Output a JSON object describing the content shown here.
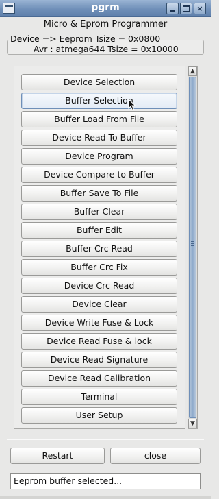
{
  "window": {
    "title": "pgrm",
    "app_title": "Micro & Eprom Programmer",
    "device_line": "Device => Eeprom Tsize = 0x0800",
    "avr_line": "Avr : atmega644  Tsize = 0x10000",
    "controls": {
      "minimize": "",
      "maximize": "",
      "close": "×"
    }
  },
  "menu_buttons": [
    "Device Selection",
    "Buffer Selection",
    "Buffer Load From File",
    "Device Read To Buffer",
    "Device Program",
    "Device Compare to Buffer",
    "Buffer Save To File",
    "Buffer Clear",
    "Buffer Edit",
    "Buffer Crc Read",
    "Buffer Crc Fix",
    "Device Crc Read",
    "Device Clear",
    "Device Write Fuse & Lock",
    "Device Read Fuse & lock",
    "Device Read Signature",
    "Device Read Calibration",
    "Terminal",
    "User Setup"
  ],
  "footer": {
    "restart_label": "Restart",
    "close_label": "close"
  },
  "status_text": "Eeprom buffer selected...",
  "scrollbar": {
    "up_arrow": "▲",
    "down_arrow": "▼"
  }
}
